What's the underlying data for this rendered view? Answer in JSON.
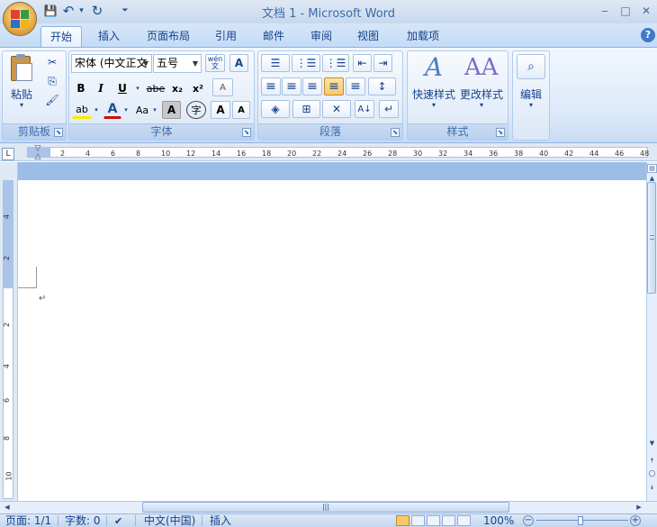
{
  "window": {
    "title": "文档 1 - Microsoft Word",
    "minimize_glyph": "‒",
    "maximize_glyph": "□",
    "close_glyph": "✕"
  },
  "quick_access": {
    "save_glyph": "💾",
    "undo_glyph": "↶",
    "undo_dropdown_glyph": "▾",
    "redo_glyph": "↻",
    "customize_glyph": "⏷"
  },
  "tabs": [
    {
      "label": "开始",
      "active": true
    },
    {
      "label": "插入"
    },
    {
      "label": "页面布局"
    },
    {
      "label": "引用"
    },
    {
      "label": "邮件"
    },
    {
      "label": "审阅"
    },
    {
      "label": "视图"
    },
    {
      "label": "加载项"
    }
  ],
  "help_glyph": "?",
  "groups": {
    "clipboard": {
      "label": "剪贴板",
      "paste_label": "粘贴",
      "cut_glyph": "✂",
      "copy_glyph": "⎘",
      "format_painter_glyph": "🖌"
    },
    "font": {
      "label": "字体",
      "font_name": "宋体 (中文正文",
      "font_size": "五号",
      "phonetic_glyph": "wén 文",
      "char_border_glyph": "A",
      "bold": "B",
      "italic": "I",
      "underline": "U",
      "strike": "abe",
      "subscript": "x₂",
      "superscript": "x²",
      "clear_format_glyph": "A",
      "highlight_glyph": "ab",
      "font_color_glyph": "A",
      "change_case": "Aa",
      "char_shading": "A",
      "enclose_char": "字",
      "grow_font": "A",
      "shrink_font": "A"
    },
    "paragraph": {
      "label": "段落",
      "bullets_glyph": "☰",
      "numbering_glyph": "⋮☰",
      "multilevel_glyph": "⋮☰",
      "decrease_indent_glyph": "⇤",
      "increase_indent_glyph": "⇥",
      "align_left_glyph": "≡",
      "center_glyph": "≡",
      "align_right_glyph": "≡",
      "justify_glyph": "≡",
      "distributed_glyph": "≡",
      "line_spacing_glyph": "↕",
      "shading_glyph": "◈",
      "borders_glyph": "⊞",
      "chinese_layout_glyph": "✕",
      "sort_glyph": "A↓",
      "show_marks_glyph": "↵"
    },
    "styles": {
      "label": "样式",
      "quick_styles": "快速样式",
      "change_styles": "更改样式"
    },
    "editing": {
      "label": "编辑",
      "find_glyph": "⌕"
    }
  },
  "ruler": {
    "corner_glyph": "L",
    "h_ticks": [
      "2",
      "4",
      "6",
      "8",
      "10",
      "12",
      "14",
      "16",
      "18",
      "20",
      "22",
      "24",
      "26",
      "28",
      "30",
      "32",
      "34",
      "36",
      "38",
      "40",
      "42",
      "44",
      "46",
      "48"
    ],
    "v_ticks": [
      "4",
      "2",
      "2",
      "4",
      "6",
      "8",
      "10"
    ]
  },
  "document": {
    "paragraph_mark": "↵"
  },
  "scroll": {
    "up": "▲",
    "down": "▼",
    "prev_page": "⯭",
    "select_browse": "○",
    "next_page": "⯯",
    "h_left": "◀",
    "h_right": "▶",
    "h_thumb_grip": "|||"
  },
  "status": {
    "page": "页面: 1/1",
    "words": "字数: 0",
    "language": "中文(中国)",
    "mode": "插入",
    "zoom": "100%"
  }
}
